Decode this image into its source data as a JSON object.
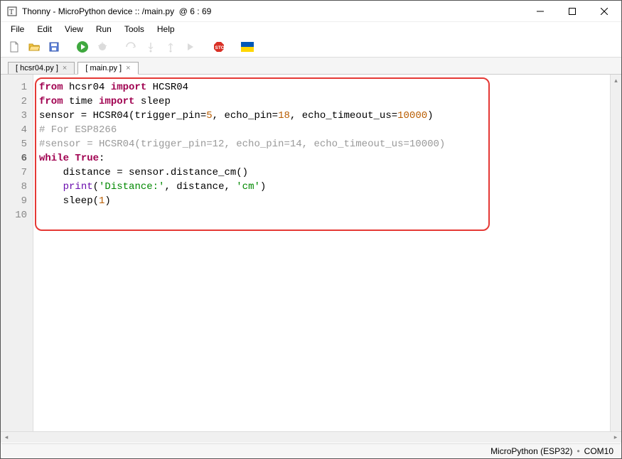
{
  "window": {
    "app_name": "Thonny",
    "title_sep": " - ",
    "device": "MicroPython device :: /main.py",
    "cursor_at": "@  6 : 69"
  },
  "menu": {
    "file": "File",
    "edit": "Edit",
    "view": "View",
    "run": "Run",
    "tools": "Tools",
    "help": "Help"
  },
  "tabs": {
    "t0": "[ hcsr04.py ]",
    "t1": "[ main.py ]"
  },
  "code": {
    "l1_from": "from",
    "l1_mod1": " hcsr04 ",
    "l1_import": "import",
    "l1_name1": " HCSR04",
    "l2_from": "from",
    "l2_mod": " time ",
    "l2_import": "import",
    "l2_name": " sleep",
    "l3_a": "sensor = HCSR04(trigger_pin=",
    "l3_n1": "5",
    "l3_b": ", echo_pin=",
    "l3_n2": "18",
    "l3_c": ", echo_timeout_us=",
    "l3_n3": "10000",
    "l3_d": ")",
    "l4": "",
    "l5": "# For ESP8266",
    "l6": "#sensor = HCSR04(trigger_pin=12, echo_pin=14, echo_timeout_us=10000)",
    "l7_while": "while",
    "l7_true": " True",
    "l7_colon": ":",
    "l8": "    distance = sensor.distance_cm()",
    "l9_a": "    ",
    "l9_print": "print",
    "l9_b": "(",
    "l9_s1": "'Distance:'",
    "l9_c": ", distance, ",
    "l9_s2": "'cm'",
    "l9_d": ")",
    "l10_a": "    sleep(",
    "l10_n": "1",
    "l10_b": ")"
  },
  "gutter": {
    "1": "1",
    "2": "2",
    "3": "3",
    "4": "4",
    "5": "5",
    "6": "6",
    "7": "7",
    "8": "8",
    "9": "9",
    "10": "10"
  },
  "status": {
    "interpreter": "MicroPython (ESP32)",
    "port": "COM10"
  }
}
